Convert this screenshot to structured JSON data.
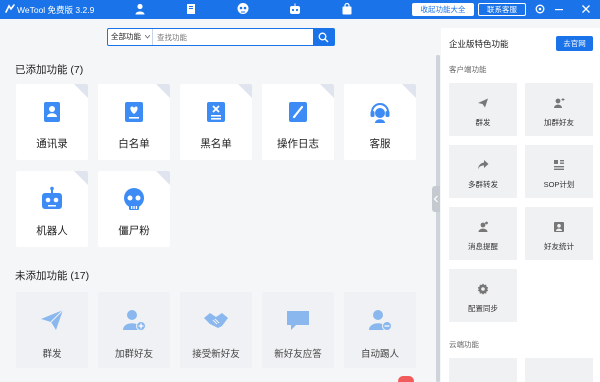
{
  "titlebar": {
    "app_title": "WeTool 免费版 3.2.9",
    "collect_label": "收起功能大全",
    "service_label": "联系客服",
    "nav_icons": [
      "person-icon",
      "book-icon",
      "skull-icon",
      "robot-icon",
      "shopping-bag-icon"
    ],
    "bg_color": "#1a73e8"
  },
  "search": {
    "category": "全部功能",
    "placeholder": "查找功能"
  },
  "added": {
    "title": "已添加功能 (7)",
    "items": [
      {
        "label": "通讯录",
        "icon": "contacts-icon"
      },
      {
        "label": "白名单",
        "icon": "whitelist-icon"
      },
      {
        "label": "黑名单",
        "icon": "blacklist-icon"
      },
      {
        "label": "操作日志",
        "icon": "log-icon"
      },
      {
        "label": "客服",
        "icon": "service-icon"
      },
      {
        "label": "机器人",
        "icon": "robot-icon"
      },
      {
        "label": "僵尸粉",
        "icon": "zombie-icon"
      }
    ]
  },
  "not_added": {
    "title": "未添加功能 (17)",
    "items": [
      {
        "label": "群发",
        "icon": "send-icon"
      },
      {
        "label": "加群好友",
        "icon": "add-group-friend-icon"
      },
      {
        "label": "接受新好友",
        "icon": "handshake-icon"
      },
      {
        "label": "新好友应答",
        "icon": "chat-bubble-icon"
      },
      {
        "label": "自动踢人",
        "icon": "kick-user-icon"
      }
    ]
  },
  "right_panel": {
    "title": "企业版特色功能",
    "visit_label": "去官网",
    "sections": [
      {
        "title": "客户端功能",
        "items": [
          {
            "label": "群发",
            "icon": "send-icon"
          },
          {
            "label": "加群好友",
            "icon": "add-friend-icon"
          },
          {
            "label": "多群转发",
            "icon": "forward-icon"
          },
          {
            "label": "SOP计划",
            "icon": "sop-icon"
          },
          {
            "label": "消息提醒",
            "icon": "bell-icon"
          },
          {
            "label": "好友统计",
            "icon": "stats-icon"
          },
          {
            "label": "配置同步",
            "icon": "settings-sync-icon"
          }
        ]
      },
      {
        "title": "云端功能",
        "items": []
      }
    ]
  },
  "colors": {
    "accent": "#1a73e8",
    "tile_icon": "#3d8bf5",
    "tile_icon_dim": "#8ab8ee",
    "page_bg": "#f5f6f8"
  }
}
